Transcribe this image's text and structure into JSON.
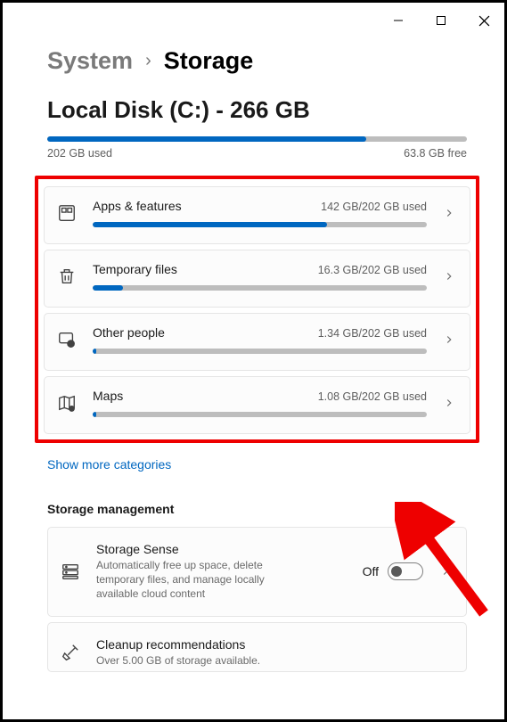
{
  "breadcrumb": {
    "parent": "System",
    "current": "Storage"
  },
  "disk": {
    "title": "Local Disk (C:) - 266 GB",
    "used_label": "202 GB used",
    "free_label": "63.8 GB free",
    "used_pct": 76
  },
  "categories": [
    {
      "name": "Apps & features",
      "usage": "142 GB/202 GB used",
      "pct": 70
    },
    {
      "name": "Temporary files",
      "usage": "16.3 GB/202 GB used",
      "pct": 9
    },
    {
      "name": "Other people",
      "usage": "1.34 GB/202 GB used",
      "pct": 1
    },
    {
      "name": "Maps",
      "usage": "1.08 GB/202 GB used",
      "pct": 1
    }
  ],
  "show_more": "Show more categories",
  "section": "Storage management",
  "storage_sense": {
    "title": "Storage Sense",
    "desc": "Automatically free up space, delete temporary files, and manage locally available cloud content",
    "state": "Off"
  },
  "cleanup": {
    "title": "Cleanup recommendations",
    "desc": "Over 5.00 GB of storage available."
  }
}
